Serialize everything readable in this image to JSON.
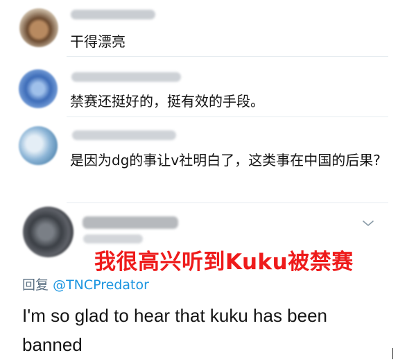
{
  "comments": [
    {
      "text": "干得漂亮"
    },
    {
      "text": "禁赛还挺好的，挺有效的手段。"
    },
    {
      "text": "是因为dg的事让v社明白了，这类事在中国的后果?"
    }
  ],
  "tweet": {
    "caption_cn": "我很高兴听到Kuku被禁赛",
    "reply_prefix": "回复",
    "reply_handle": "@TNCPredator",
    "text": "I'm so glad to hear that kuku has been banned"
  },
  "colors": {
    "caption": "#ee1b1b",
    "handle": "#1b95e0",
    "muted": "#5b7083"
  },
  "icons": {
    "more": "chevron-down-icon"
  }
}
